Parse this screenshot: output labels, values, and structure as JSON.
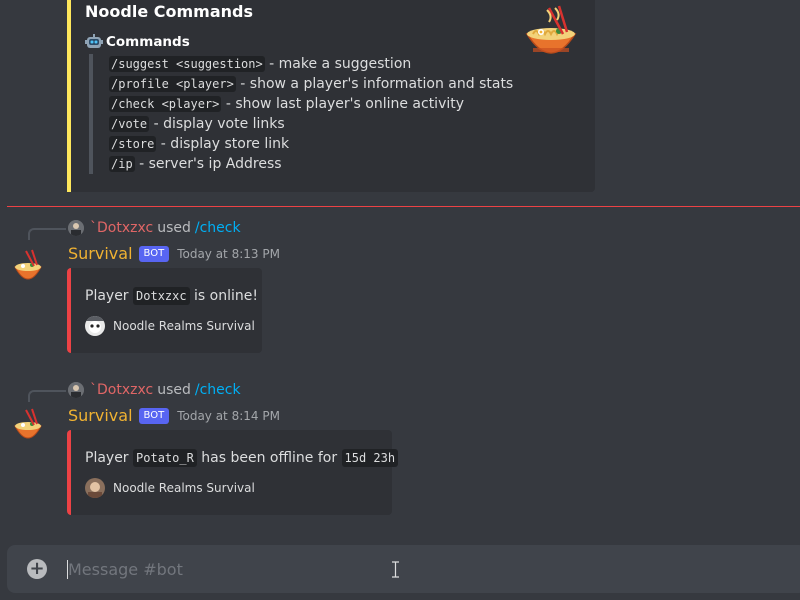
{
  "top_embed": {
    "title": "Noodle Commands",
    "field_name": "Commands",
    "commands": [
      {
        "cmd": "/suggest <suggestion>",
        "desc": " - make a suggestion"
      },
      {
        "cmd": "/profile <player>",
        "desc": " - show a player's information and stats"
      },
      {
        "cmd": "/check <player>",
        "desc": " - show last player's online activity"
      },
      {
        "cmd": "/vote",
        "desc": " - display vote links"
      },
      {
        "cmd": "/store",
        "desc": " - display store link"
      },
      {
        "cmd": "/ip",
        "desc": " - server's ip Address"
      }
    ]
  },
  "messages": [
    {
      "reply": {
        "name": "`Dotxzxc",
        "used": "used",
        "command": "/check"
      },
      "username": "Survival",
      "bot_tag": "BOT",
      "timestamp": "Today at 8:13 PM",
      "desc_prefix": "Player ",
      "player": "Dotxzxc",
      "desc_suffix": " is online!",
      "footer": "Noodle Realms Survival"
    },
    {
      "reply": {
        "name": "`Dotxzxc",
        "used": "used",
        "command": "/check"
      },
      "username": "Survival",
      "bot_tag": "BOT",
      "timestamp": "Today at 8:14 PM",
      "desc_prefix": "Player ",
      "player": "Potato_R",
      "desc_middle": " has been offline for ",
      "duration": "15d 23h",
      "footer": "Noodle Realms Survival"
    }
  ],
  "input": {
    "placeholder": "Message #bot",
    "plus_icon": "+"
  },
  "colors": {
    "background": "#36393f",
    "embed_bg": "#2f3136",
    "top_embed_accent": "#fee75c",
    "message_embed_accent": "#ed4245",
    "username": "#f0b232",
    "bot_tag": "#5865f2",
    "link": "#00aff4"
  }
}
